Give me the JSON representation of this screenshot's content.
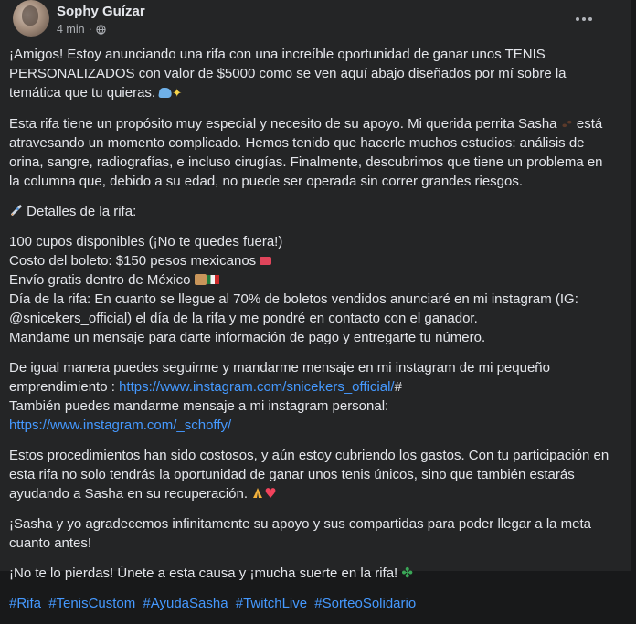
{
  "post": {
    "author": "Sophy Guízar",
    "time": "4 min",
    "separator": "·",
    "paragraphs": {
      "p1": "¡Amigos! Estoy anunciando una rifa con una increíble oportunidad de ganar unos TENIS PERSONALIZADOS con valor de $5000 como se ven aquí abajo diseñados por mí sobre la temática que tu quieras.",
      "p2": "Esta rifa tiene un propósito muy especial y necesito de su apoyo. Mi querida perrita Sasha",
      "p2b": "está atravesando un momento complicado. Hemos tenido que hacerle muchos estudios: análisis de orina, sangre, radiografías, e incluso cirugías. Finalmente, descubrimos que tiene un problema en la columna que, debido a su edad, no puede ser operada sin correr grandes riesgos.",
      "details_heading": "Detalles de la rifa:",
      "d1": "100 cupos disponibles (¡No te quedes fuera!)",
      "d2": "Costo del boleto: $150 pesos mexicanos",
      "d3": "Envío gratis dentro de México",
      "d4": "Día de la rifa: En cuanto se llegue al 70% de boletos vendidos anunciaré en mi instagram (IG: @snicekers_official) el día de la rifa y me pondré en contacto con el ganador.",
      "d5": "Mandame un mensaje para darte información de pago y entregarte tu número.",
      "p4a": "De igual manera puedes seguirme y mandarme mensaje en mi instagram de mi pequeño emprendimiento :",
      "link1": "https://www.instagram.com/snicekers_official/",
      "p4hash": "#",
      "p4b": "También puedes mandarme mensaje a mi instagram personal:",
      "link2": "https://www.instagram.com/_schoffy/",
      "p5": "Estos procedimientos han sido costosos, y aún estoy cubriendo los gastos. Con tu participación en esta rifa no solo tendrás la oportunidad de ganar unos tenis únicos, sino que también estarás ayudando a Sasha en su recuperación.",
      "p6": "¡Sasha y yo agradecemos infinitamente su apoyo y sus compartidas para poder llegar a la meta cuanto antes!",
      "p7": "¡No te lo pierdas! Únete a esta causa y ¡mucha suerte en la rifa!"
    },
    "hashtags": [
      "#Rifa",
      "#TenisCustom",
      "#AyudaSasha",
      "#TwitchLive",
      "#SorteoSolidario"
    ],
    "icons": {
      "audience": "globe-icon",
      "options": "more-options-icon",
      "emoji_shoe": "sneaker-emoji",
      "emoji_sparkle": "sparkles-emoji",
      "emoji_paw": "paw-prints-emoji",
      "emoji_rocket": "rocket-emoji",
      "emoji_ticket": "ticket-emoji",
      "emoji_box": "package-emoji",
      "emoji_flag": "mexico-flag-emoji",
      "emoji_pray": "folded-hands-emoji",
      "emoji_heart": "red-heart-emoji",
      "emoji_clover": "four-leaf-clover-emoji"
    },
    "colors": {
      "background": "#242526",
      "text": "#e4e6eb",
      "secondary": "#b0b3b8",
      "link": "#4599ff"
    }
  }
}
